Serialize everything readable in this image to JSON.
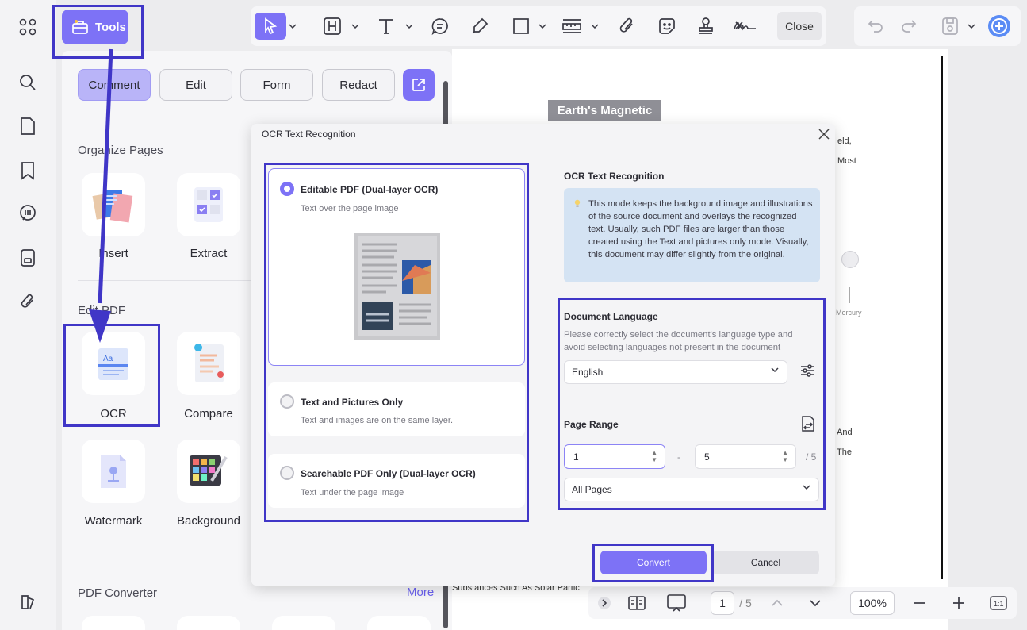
{
  "toolbar": {
    "tools_label": "Tools",
    "close_label": "Close"
  },
  "panel": {
    "tabs": [
      "Comment",
      "Edit",
      "Form",
      "Redact"
    ],
    "sections": {
      "organize": "Organize Pages",
      "edit_pdf": "Edit PDF",
      "converter": "PDF Converter"
    },
    "tools": {
      "insert": "Insert",
      "extract": "Extract",
      "ocr": "OCR",
      "compare": "Compare",
      "watermark": "Watermark",
      "background": "Background"
    },
    "more_label": "More"
  },
  "document": {
    "badge": "Earth's Magnetic",
    "fragments": [
      "eld,",
      "Most",
      "Mercury",
      "And",
      "The"
    ],
    "bottom_text": "Substances Such As Solar Partic"
  },
  "bottom_bar": {
    "page_current": "1",
    "page_total": "/ 5",
    "zoom": "100%"
  },
  "dialog": {
    "title": "OCR Text Recognition",
    "options": [
      {
        "title": "Editable PDF (Dual-layer OCR)",
        "desc": "Text over the page image"
      },
      {
        "title": "Text and Pictures Only",
        "desc": "Text and images are on the same layer."
      },
      {
        "title": "Searchable PDF Only (Dual-layer OCR)",
        "desc": "Text under the page image"
      }
    ],
    "right_title": "OCR Text Recognition",
    "info_text": "This mode keeps the background image and illustrations of the source document and overlays the recognized text. Usually, such PDF files are larger than those created using the Text and pictures only mode. Visually, this document may differ slightly from the original.",
    "language_title": "Document Language",
    "language_desc": "Please correctly select the document's language type and avoid selecting languages not present in the document",
    "language_value": "English",
    "page_range_title": "Page Range",
    "range_from": "1",
    "range_dash": "-",
    "range_to": "5",
    "range_total": "/ 5",
    "range_mode": "All Pages",
    "convert_label": "Convert",
    "cancel_label": "Cancel"
  },
  "colors": {
    "accent": "#7d72f6",
    "highlight": "#4036c7",
    "info_bg": "#d4e3f3"
  }
}
